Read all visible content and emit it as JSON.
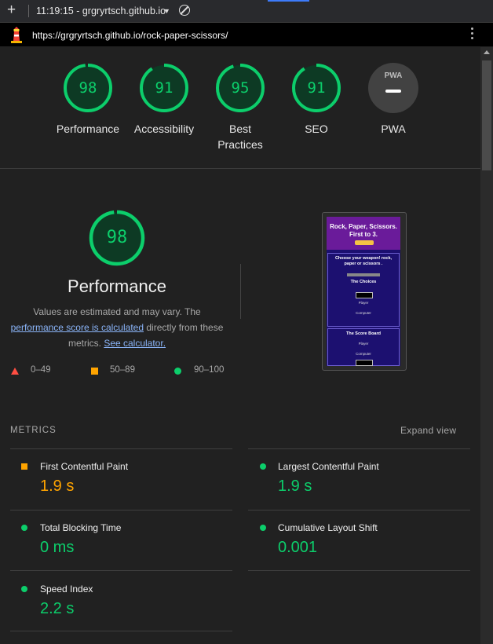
{
  "browser": {
    "time_title": "11:19:15 - grgryrtsch.github.io",
    "url": "https://grgryrtsch.github.io/rock-paper-scissors/"
  },
  "scores": [
    {
      "label": "Performance",
      "value": "98",
      "fraction": 0.98
    },
    {
      "label": "Accessibility",
      "value": "91",
      "fraction": 0.91
    },
    {
      "label": "Best Practices",
      "value": "95",
      "fraction": 0.95
    },
    {
      "label": "SEO",
      "value": "91",
      "fraction": 0.91
    }
  ],
  "pwa": {
    "label": "PWA",
    "badge": "PWA"
  },
  "performance": {
    "score": "98",
    "fraction": 0.98,
    "title": "Performance",
    "desc_1": "Values are estimated and may vary. The",
    "desc_link": "performance score is calculated",
    "desc_2": "directly from these metrics.",
    "calc_link": "See calculator."
  },
  "legend": {
    "fail": "0–49",
    "average": "50–89",
    "pass": "90–100"
  },
  "screenshot": {
    "title": "Rock, Paper, Scissors. First to 3.",
    "prompt": "Choose your weapon! rock, paper or scissors .",
    "choices": "The Choices",
    "player": "Player",
    "computer": "Computer",
    "scoreboard": "The Score Board"
  },
  "metrics": {
    "heading": "METRICS",
    "expand": "Expand view",
    "items": [
      {
        "title": "First Contentful Paint",
        "value": "1.9 s",
        "status": "average"
      },
      {
        "title": "Largest Contentful Paint",
        "value": "1.9 s",
        "status": "pass"
      },
      {
        "title": "Total Blocking Time",
        "value": "0 ms",
        "status": "pass"
      },
      {
        "title": "Cumulative Layout Shift",
        "value": "0.001",
        "status": "pass"
      },
      {
        "title": "Speed Index",
        "value": "2.2 s",
        "status": "pass"
      }
    ]
  },
  "colors": {
    "pass": "#0cce6b",
    "average": "#ffa400",
    "fail": "#ff4e42"
  }
}
